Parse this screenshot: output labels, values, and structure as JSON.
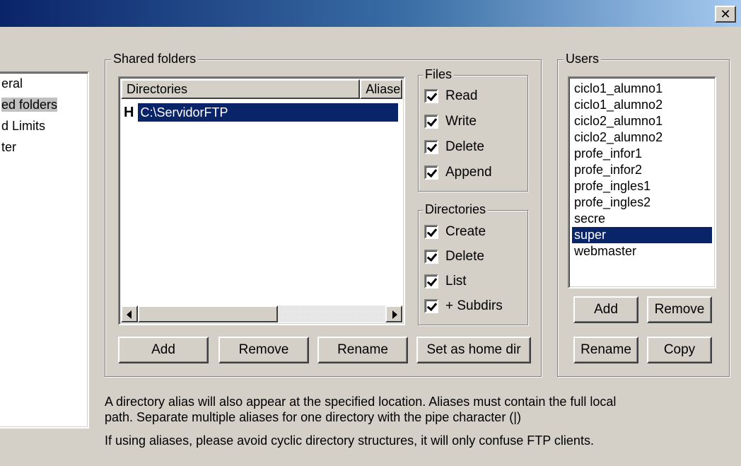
{
  "window": {
    "close_glyph": "✕"
  },
  "nav": {
    "items": [
      {
        "label": "eral",
        "selected": false
      },
      {
        "label": "ed folders",
        "selected": true
      },
      {
        "label": "d Limits",
        "selected": false
      },
      {
        "label": "ter",
        "selected": false
      }
    ]
  },
  "shared_folders": {
    "legend": "Shared folders",
    "columns": [
      "Directories",
      "Aliases"
    ],
    "rows": [
      {
        "home_marker": "H",
        "path": "C:\\ServidorFTP",
        "selected": true
      }
    ],
    "buttons": {
      "add": "Add",
      "remove": "Remove",
      "rename": "Rename",
      "set_home": "Set as home dir"
    }
  },
  "files": {
    "legend": "Files",
    "options": [
      {
        "label": "Read",
        "checked": true
      },
      {
        "label": "Write",
        "checked": true
      },
      {
        "label": "Delete",
        "checked": true
      },
      {
        "label": "Append",
        "checked": true
      }
    ]
  },
  "directories": {
    "legend": "Directories",
    "options": [
      {
        "label": "Create",
        "checked": true
      },
      {
        "label": "Delete",
        "checked": true
      },
      {
        "label": "List",
        "checked": true
      },
      {
        "label": "+ Subdirs",
        "checked": true
      }
    ]
  },
  "users": {
    "legend": "Users",
    "items": [
      "ciclo1_alumno1",
      "ciclo1_alumno2",
      "ciclo2_alumno1",
      "ciclo2_alumno2",
      "profe_infor1",
      "profe_infor2",
      "profe_ingles1",
      "profe_ingles2",
      "secre",
      "super",
      "webmaster"
    ],
    "selected": "super",
    "buttons": {
      "add": "Add",
      "remove": "Remove",
      "rename": "Rename",
      "copy": "Copy"
    }
  },
  "info": {
    "line1": "A directory alias will also appear at the specified location. Aliases must contain the full local",
    "line2": "path. Separate multiple aliases for one directory with the pipe character (|)",
    "line3": "If using aliases, please avoid cyclic directory structures, it will only confuse FTP clients."
  },
  "icons": {
    "close": "close-icon",
    "scroll_left": "arrow-left-icon",
    "scroll_right": "arrow-right-icon"
  }
}
